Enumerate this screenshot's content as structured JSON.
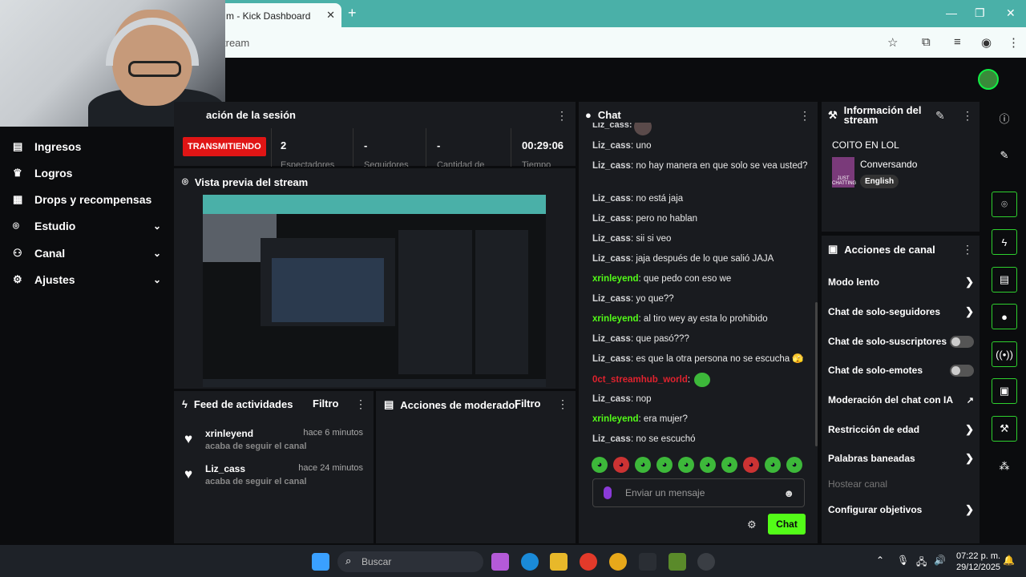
{
  "browser": {
    "tab_title": "m - Kick Dashboard",
    "url": "tream",
    "tab_close": "✕",
    "new_tab": "+"
  },
  "sidebar": {
    "items": [
      {
        "label": "Ingresos",
        "icon": "wallet-icon",
        "glyph": "▤"
      },
      {
        "label": "Logros",
        "icon": "trophy-icon",
        "glyph": "♛"
      },
      {
        "label": "Drops y recompensas",
        "icon": "gift-icon",
        "glyph": "▦"
      },
      {
        "label": "Estudio",
        "icon": "studio-icon",
        "glyph": "⌾",
        "chevron": "⌄"
      },
      {
        "label": "Canal",
        "icon": "users-icon",
        "glyph": "⚇",
        "chevron": "⌄"
      },
      {
        "label": "Ajustes",
        "icon": "gear-icon",
        "glyph": "⚙",
        "chevron": "⌄"
      }
    ]
  },
  "session": {
    "title": "ación de la sesión",
    "status": "TRANSMITIENDO",
    "stats": [
      "2",
      "-",
      "-",
      "00:29:06"
    ],
    "stat_subs": [
      "Espectadores",
      "Seguidores",
      "Cantidad de",
      "Tiempo"
    ]
  },
  "preview": {
    "title": "Vista previa del stream"
  },
  "feed": {
    "title": "Feed de actividades",
    "filter": "Filtro",
    "items": [
      {
        "name": "xrinleyend",
        "time": "hace 6 minutos",
        "sub": "acaba de seguir el canal"
      },
      {
        "name": "Liz_cass",
        "time": "hace 24 minutos",
        "sub": "acaba de seguir el canal"
      }
    ]
  },
  "moderator": {
    "title": "Acciones de moderador",
    "filter": "Filtro"
  },
  "chat": {
    "title": "Chat",
    "partial_user": "Liz_cass:",
    "messages": [
      {
        "user": "Liz_cass",
        "text": "uno"
      },
      {
        "user": "Liz_cass",
        "text": "no hay manera en que solo se vea usted?"
      },
      {
        "user": "Liz_cass",
        "text": "no está jaja"
      },
      {
        "user": "Liz_cass",
        "text": "pero no hablan"
      },
      {
        "user": "Liz_cass",
        "text": "sii si veo"
      },
      {
        "user": "Liz_cass",
        "text": "jaja después de lo que salió JAJA"
      },
      {
        "user": "xrinleyend",
        "text": "que pedo con eso we",
        "color": "#53fc18"
      },
      {
        "user": "Liz_cass",
        "text": "yo que??"
      },
      {
        "user": "xrinleyend",
        "text": "al tiro wey ay esta lo prohibido",
        "color": "#53fc18"
      },
      {
        "user": "Liz_cass",
        "text": "que pasó???"
      },
      {
        "user": "Liz_cass",
        "text": "es que la otra persona no se escucha 🫣"
      },
      {
        "user": "0ct_streamhub_world",
        "text": "",
        "color": "#e0222e",
        "emote": true
      },
      {
        "user": "Liz_cass",
        "text": "nop"
      },
      {
        "user": "xrinleyend",
        "text": "era mujer?",
        "color": "#53fc18"
      },
      {
        "user": "Liz_cass",
        "text": "no se escuchó"
      }
    ],
    "placeholder": "Enviar un mensaje",
    "send_label": "Chat"
  },
  "stream_info": {
    "title": "Información del stream",
    "stream_title": "COITO EN LOL",
    "category": "Conversando",
    "language": "English",
    "thumb_text": "JUST CHATTING"
  },
  "channel_actions": {
    "title": "Acciones de canal",
    "items": [
      {
        "label": "Modo lento",
        "kind": "arrow"
      },
      {
        "label": "Chat de solo-seguidores",
        "kind": "arrow"
      },
      {
        "label": "Chat de solo-suscriptores",
        "kind": "toggle"
      },
      {
        "label": "Chat de solo-emotes",
        "kind": "toggle"
      },
      {
        "label": "Moderación del chat con IA",
        "kind": "external"
      },
      {
        "label": "Restricción de edad",
        "kind": "arrow"
      },
      {
        "label": "Palabras baneadas",
        "kind": "arrow"
      },
      {
        "label": "Hostear canal",
        "kind": "disabled"
      },
      {
        "label": "Configurar objetivos",
        "kind": "arrow"
      }
    ]
  },
  "taskbar": {
    "search_label": "Buscar",
    "time": "07:22 p. m.",
    "date": "29/12/2025"
  },
  "colors": {
    "accent": "#53fc18",
    "live": "#e01515",
    "panel": "#191b1f",
    "bg": "#0b0c0e",
    "browser": "#4ab0a8"
  }
}
